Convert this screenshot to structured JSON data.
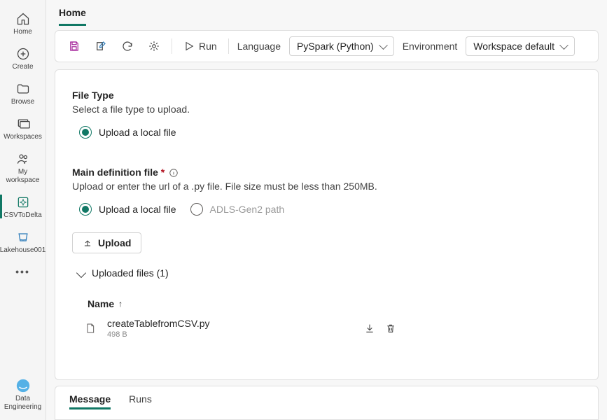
{
  "leftrail": {
    "items": [
      {
        "label": "Home"
      },
      {
        "label": "Create"
      },
      {
        "label": "Browse"
      },
      {
        "label": "Workspaces"
      },
      {
        "label": "My workspace"
      },
      {
        "label": "CSVToDelta"
      },
      {
        "label": "Lakehouse001"
      }
    ],
    "bottom": {
      "label": "Data Engineering"
    }
  },
  "tab": {
    "title": "Home"
  },
  "toolbar": {
    "run_label": "Run",
    "language_label": "Language",
    "language_value": "PySpark (Python)",
    "environment_label": "Environment",
    "environment_value": "Workspace default"
  },
  "file_type": {
    "title": "File Type",
    "subtitle": "Select a file type to upload.",
    "options": [
      {
        "label": "Upload a local file",
        "selected": true
      }
    ]
  },
  "main_def": {
    "title": "Main definition file",
    "required_marker": "*",
    "subtitle": "Upload or enter the url of a .py file. File size must be less than 250MB.",
    "options": [
      {
        "label": "Upload a local file",
        "selected": true
      },
      {
        "label": "ADLS-Gen2 path",
        "selected": false
      }
    ],
    "upload_button": "Upload",
    "uploaded_header": "Uploaded files (1)",
    "name_col": "Name",
    "files": [
      {
        "name": "createTablefromCSV.py",
        "size": "498 B"
      }
    ]
  },
  "bottom_tabs": {
    "items": [
      {
        "label": "Message",
        "active": true
      },
      {
        "label": "Runs",
        "active": false
      }
    ]
  }
}
